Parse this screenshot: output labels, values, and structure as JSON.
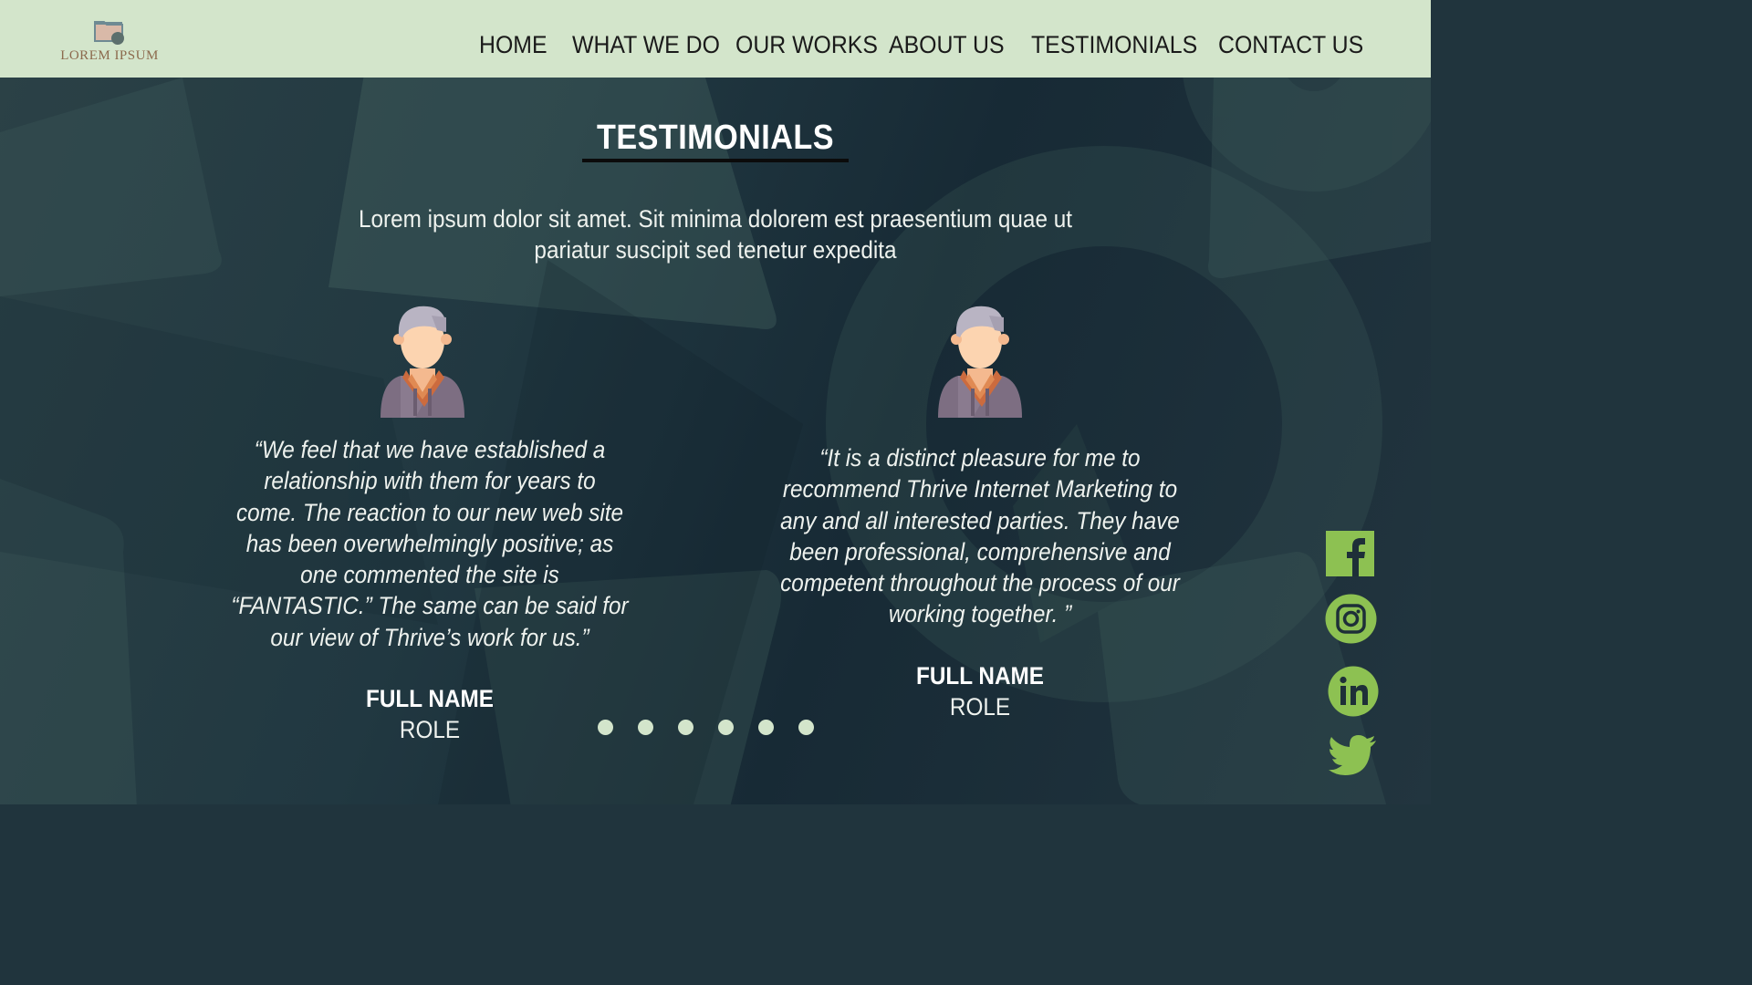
{
  "header": {
    "logo_text": "LOREM IPSUM",
    "nav": [
      {
        "label": "HOME"
      },
      {
        "label": "WHAT WE DO"
      },
      {
        "label": "OUR WORKS"
      },
      {
        "label": "ABOUT US"
      },
      {
        "label": "TESTIMONIALS"
      },
      {
        "label": "CONTACT US"
      }
    ]
  },
  "testimonials": {
    "title": "TESTIMONIALS",
    "intro_line1": "Lorem ipsum dolor sit amet. Sit minima dolorem  est praesentium quae ut",
    "intro_line2": "pariatur suscipit sed tenetur expedita",
    "cards": [
      {
        "quote_lines": [
          "“We feel that we have established a",
          "relationship with them for years to",
          "come. The reaction to our new web site",
          "has been overwhelmingly positive; as",
          "one commented the site is",
          "“FANTASTIC.” The same can be said for",
          "our view of Thrive’s work for us.”"
        ],
        "name": "FULL NAME",
        "role": "ROLE"
      },
      {
        "quote_lines": [
          "“It is a distinct pleasure for me to",
          "recommend Thrive Internet Marketing to",
          "any and all interested parties. They have",
          "been professional, comprehensive and",
          "competent throughout the process of our",
          "working together. ”"
        ],
        "name": "FULL NAME",
        "role": "ROLE"
      }
    ],
    "carousel_dot_count": 6
  },
  "social": {
    "icons": [
      "facebook-icon",
      "instagram-icon",
      "linkedin-icon",
      "twitter-icon"
    ],
    "color": "#8dc152"
  },
  "colors": {
    "header_bg": "#d3e5cb",
    "accent": "#8dc152",
    "hero_bg": "#20343d"
  }
}
